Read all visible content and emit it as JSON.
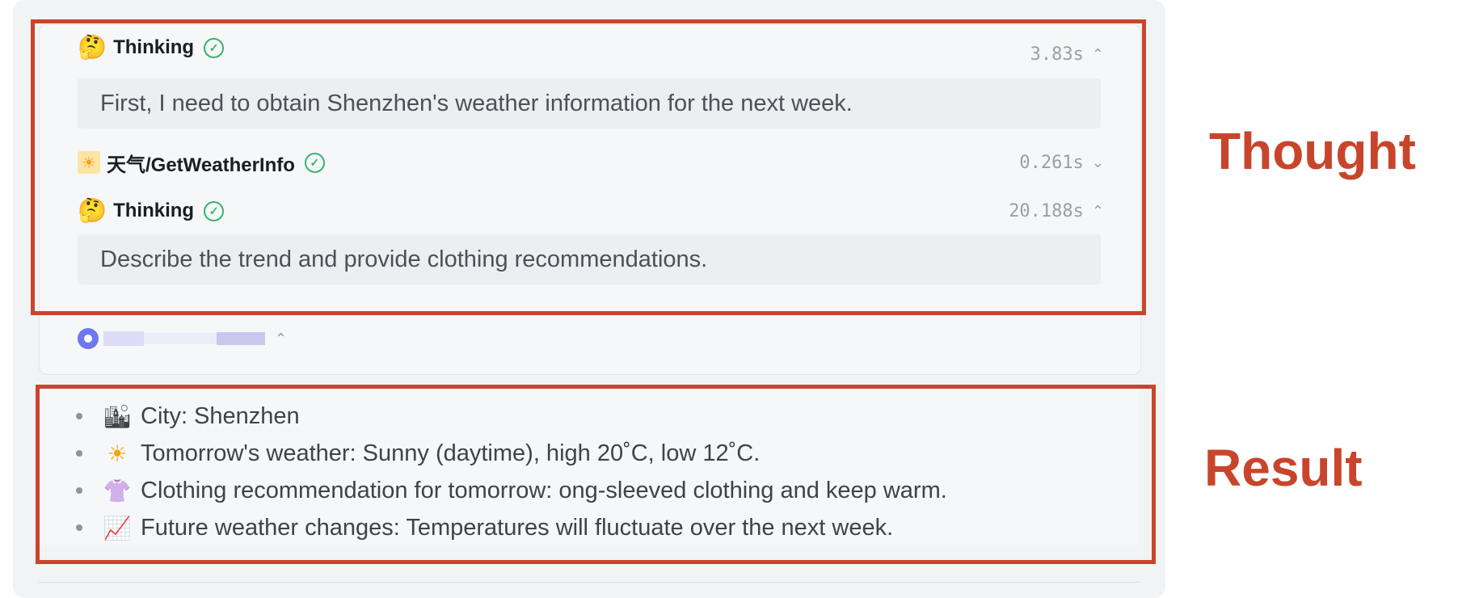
{
  "steps": [
    {
      "emoji": "🤔",
      "title": "Thinking",
      "duration": "3.83s",
      "expanded": true,
      "content": "First, I need to obtain Shenzhen's weather information for the next week."
    },
    {
      "emoji": "☀",
      "title": "天气/GetWeatherInfo",
      "duration": "0.261s",
      "expanded": false
    },
    {
      "emoji": "🤔",
      "title": "Thinking",
      "duration": "20.188s",
      "expanded": true,
      "content": "Describe the trend and provide clothing recommendations."
    }
  ],
  "icons": {
    "check": "✓",
    "chevron_up": "⌃",
    "chevron_down": "⌄"
  },
  "result": {
    "items": [
      {
        "icon": "🏙",
        "text": "City: Shenzhen"
      },
      {
        "icon": "☀",
        "text": "Tomorrow's weather: Sunny (daytime), high 20˚C, low 12˚C."
      },
      {
        "icon": "👚",
        "text": "Clothing recommendation for tomorrow: ong-sleeved clothing and keep warm."
      },
      {
        "icon": "📈",
        "text": "Future weather changes: Temperatures will fluctuate over the next week."
      }
    ]
  },
  "annotations": {
    "thought_label": "Thought",
    "result_label": "Result"
  },
  "colors": {
    "annotation_red": "#c8452c",
    "success_green": "#39b36b",
    "agent_purple": "#6d77ef"
  }
}
